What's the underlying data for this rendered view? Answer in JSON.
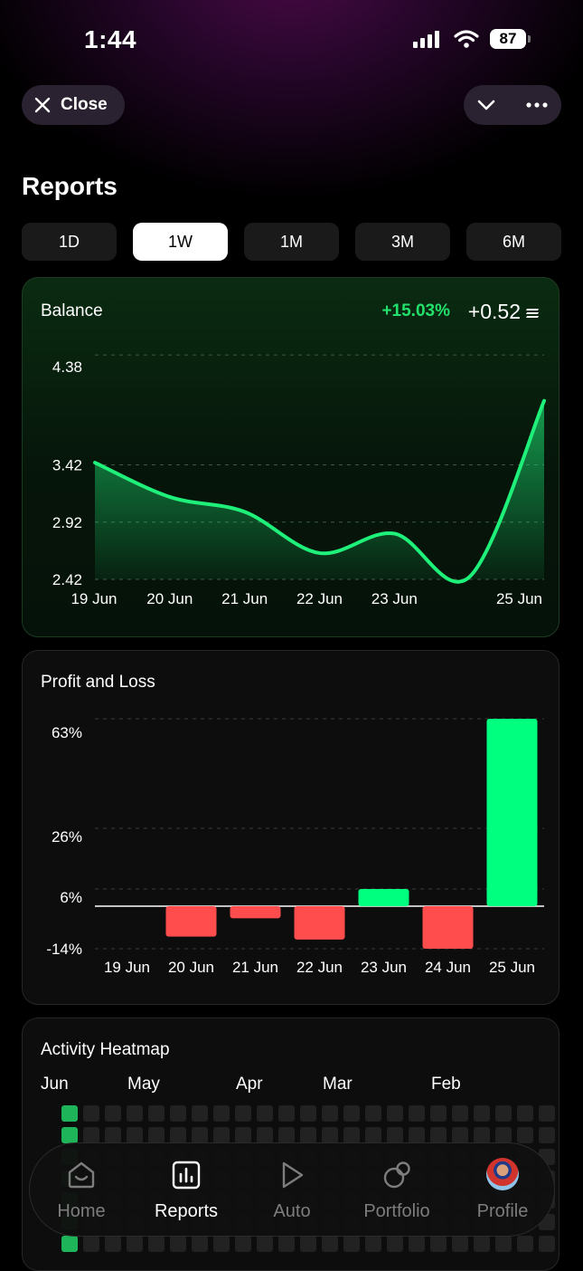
{
  "status_bar": {
    "time": "1:44",
    "battery": "87"
  },
  "header": {
    "close_label": "Close"
  },
  "page_title": "Reports",
  "ranges": [
    {
      "label": "1D",
      "active": false
    },
    {
      "label": "1W",
      "active": true
    },
    {
      "label": "1M",
      "active": false
    },
    {
      "label": "3M",
      "active": false
    },
    {
      "label": "6M",
      "active": false
    }
  ],
  "balance_card": {
    "title": "Balance",
    "change_pct": "+15.03%",
    "change_value": "+0.52"
  },
  "pnl_card": {
    "title": "Profit and Loss"
  },
  "heatmap_card": {
    "title": "Activity Heatmap",
    "months": [
      "Jun",
      "May",
      "Apr",
      "Mar",
      "Feb"
    ]
  },
  "nav": [
    {
      "label": "Home",
      "icon": "home-icon",
      "active": false
    },
    {
      "label": "Reports",
      "icon": "chart-icon",
      "active": true
    },
    {
      "label": "Auto",
      "icon": "play-icon",
      "active": false
    },
    {
      "label": "Portfolio",
      "icon": "portfolio-icon",
      "active": false
    },
    {
      "label": "Profile",
      "icon": "avatar",
      "active": false
    }
  ],
  "colors": {
    "accent_green": "#22e06b",
    "bar_green": "#00ff7f",
    "bar_red": "#ff4d4d",
    "line_green": "#1ef07a"
  },
  "chart_data": [
    {
      "type": "area",
      "title": "Balance",
      "x": [
        "19 Jun",
        "20 Jun",
        "21 Jun",
        "22 Jun",
        "23 Jun",
        "24 Jun",
        "25 Jun"
      ],
      "x_tick_labels": [
        "19 Jun",
        "20 Jun",
        "21 Jun",
        "22 Jun",
        "23 Jun",
        "25 Jun"
      ],
      "y_ticks": [
        "4.38",
        "3.42",
        "2.92",
        "2.42"
      ],
      "values": [
        3.44,
        3.14,
        3.01,
        2.65,
        2.82,
        2.44,
        3.98
      ],
      "ylim": [
        2.42,
        4.5
      ],
      "grid": true
    },
    {
      "type": "bar",
      "title": "Profit and Loss",
      "categories": [
        "19 Jun",
        "20 Jun",
        "21 Jun",
        "22 Jun",
        "23 Jun",
        "24 Jun",
        "25 Jun"
      ],
      "values": [
        0,
        -10,
        -4,
        -11,
        6,
        -14,
        63
      ],
      "y_ticks": [
        "63%",
        "26%",
        "6%",
        "-14%"
      ],
      "unit": "%",
      "grid": true
    }
  ]
}
